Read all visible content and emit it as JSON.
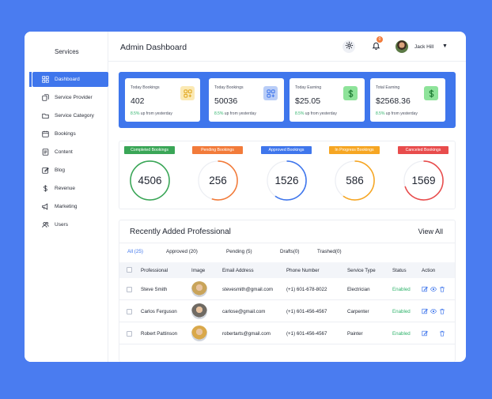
{
  "sidebar": {
    "brand": "Services",
    "items": [
      {
        "label": "Dashboard",
        "icon": "grid-icon",
        "active": true
      },
      {
        "label": "Service Provider",
        "icon": "copy-icon"
      },
      {
        "label": "Service Category",
        "icon": "folder-icon"
      },
      {
        "label": "Bookings",
        "icon": "calendar-icon"
      },
      {
        "label": "Content",
        "icon": "document-icon"
      },
      {
        "label": "Blog",
        "icon": "edit-icon"
      },
      {
        "label": "Revenue",
        "icon": "dollar-icon"
      },
      {
        "label": "Marketing",
        "icon": "megaphone-icon"
      },
      {
        "label": "Users",
        "icon": "users-icon"
      }
    ]
  },
  "header": {
    "title": "Admin Dashboard",
    "notification_count": "0",
    "user_name": "Jack Hill"
  },
  "stats": [
    {
      "label": "Today Bookings",
      "value": "402",
      "pct": "8.5%",
      "sub": "up from yesterday",
      "icon": "grid-icon",
      "icon_bg": "#fbe9b4",
      "icon_color": "#e0a51a"
    },
    {
      "label": "Today Bookings",
      "value": "50036",
      "pct": "8.5%",
      "sub": "up from yesterday",
      "icon": "grid-icon",
      "icon_bg": "#b9cdf7",
      "icon_color": "#3f76ec"
    },
    {
      "label": "Today Earning",
      "value": "$25.05",
      "pct": "8.5%",
      "sub": "up from yesterday",
      "icon": "dollar-icon",
      "icon_bg": "#8ee39a",
      "icon_color": "#1d7a33"
    },
    {
      "label": "Total Earning",
      "value": "$2568.36",
      "pct": "8.5%",
      "sub": "up from yesterday",
      "icon": "dollar-icon",
      "icon_bg": "#8ee39a",
      "icon_color": "#1d7a33"
    }
  ],
  "rings": [
    {
      "label": "Completed Bookings",
      "value": "4506",
      "color": "#3aa657",
      "fill": 1.0
    },
    {
      "label": "Pending Bookings",
      "value": "256",
      "color": "#f27b3a",
      "fill": 0.55
    },
    {
      "label": "Approved Bookings",
      "value": "1526",
      "color": "#3f76ec",
      "fill": 0.6
    },
    {
      "label": "In Progress Bookings",
      "value": "586",
      "color": "#f6a623",
      "fill": 0.6
    },
    {
      "label": "Canceled Bookings",
      "value": "1569",
      "color": "#e84c4c",
      "fill": 0.7
    }
  ],
  "professionals": {
    "title": "Recently Added Professional",
    "view_all": "View All",
    "tabs": [
      "All (25)",
      "Approved (20)",
      "Pending (5)",
      "Drafts(0)",
      "Trashed(0)"
    ],
    "columns": [
      "Professional",
      "Image",
      "Email Address",
      "Phone Number",
      "Service Type",
      "Status",
      "Action"
    ],
    "rows": [
      {
        "name": "Steve Smith",
        "email": "stevesmith@gmail.com",
        "phone": "(+1) 601-678-8022",
        "service": "Electrician",
        "status": "Enabled",
        "photo_bg": "#c9a45a"
      },
      {
        "name": "Carlos Ferguson",
        "email": "carlose@gmail.com",
        "phone": "(+1) 601-456-4567",
        "service": "Carpenter",
        "status": "Enabled",
        "photo_bg": "#6f6a63"
      },
      {
        "name": "Robert Pattinson",
        "email": "robertarts@gmail.com",
        "phone": "(+1) 601-456-4567",
        "service": "Painter",
        "status": "Enabled",
        "photo_bg": "#d9a84a"
      }
    ]
  }
}
